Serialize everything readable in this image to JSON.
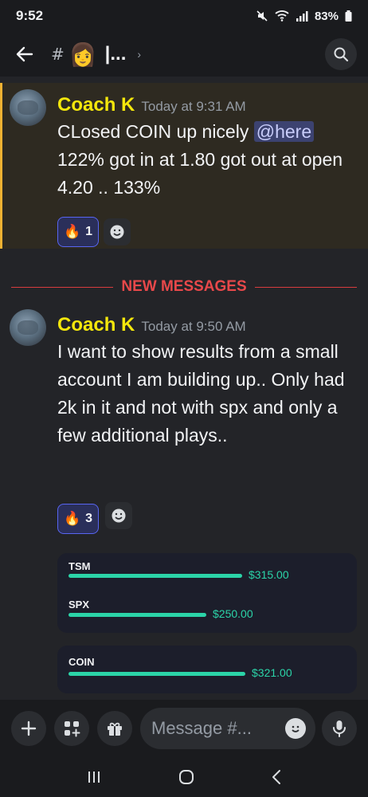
{
  "status": {
    "time": "9:52",
    "battery": "83%"
  },
  "header": {
    "title": "|...",
    "channel_emoji": "👩"
  },
  "messages": [
    {
      "author": "Coach K",
      "timestamp": "Today at 9:31 AM",
      "text_before_mention": "CLosed COIN up nicely ",
      "mention": "@here",
      "text_after_mention": " 122% got in at 1.80 got out at open 4.20  .. 133%",
      "reaction": {
        "emoji": "🔥",
        "count": "1"
      }
    },
    {
      "author": "Coach K",
      "timestamp": "Today at 9:50 AM",
      "text": "I want to show results from a small account I am building up.. Only had 2k in it and not with spx and only a few additional plays..",
      "reaction": {
        "emoji": "🔥",
        "count": "3"
      }
    }
  ],
  "divider": {
    "label": "NEW MESSAGES"
  },
  "results": [
    {
      "ticker": "TSM",
      "amount": "$315.00",
      "value": 315
    },
    {
      "ticker": "SPX",
      "amount": "$250.00",
      "value": 250
    },
    {
      "ticker": "COIN",
      "amount": "$321.00",
      "value": 321
    }
  ],
  "composer": {
    "placeholder": "Message #..."
  },
  "colors": {
    "author": "#f4e70c",
    "accent": "#5865f2",
    "gain": "#2bd4a8",
    "new_divider": "#e8484a"
  }
}
